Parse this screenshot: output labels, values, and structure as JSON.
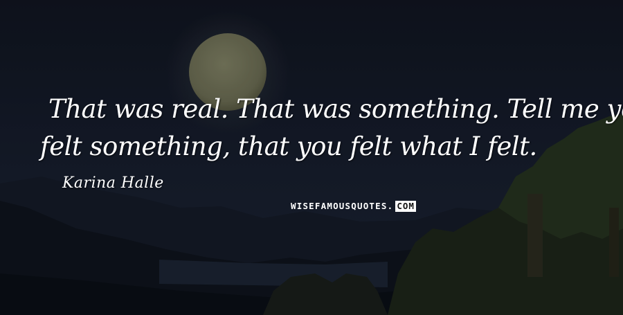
{
  "quote": {
    "line1": "That was real. That was something. Tell me you",
    "line2": "felt something, that you felt what I felt."
  },
  "author": "Karina Halle",
  "watermark": {
    "text": "WISEFAMOUSQUOTES.",
    "code": "COM"
  },
  "colors": {
    "sky": "#111827",
    "moon": "#6d6e56",
    "text": "#ffffff"
  }
}
